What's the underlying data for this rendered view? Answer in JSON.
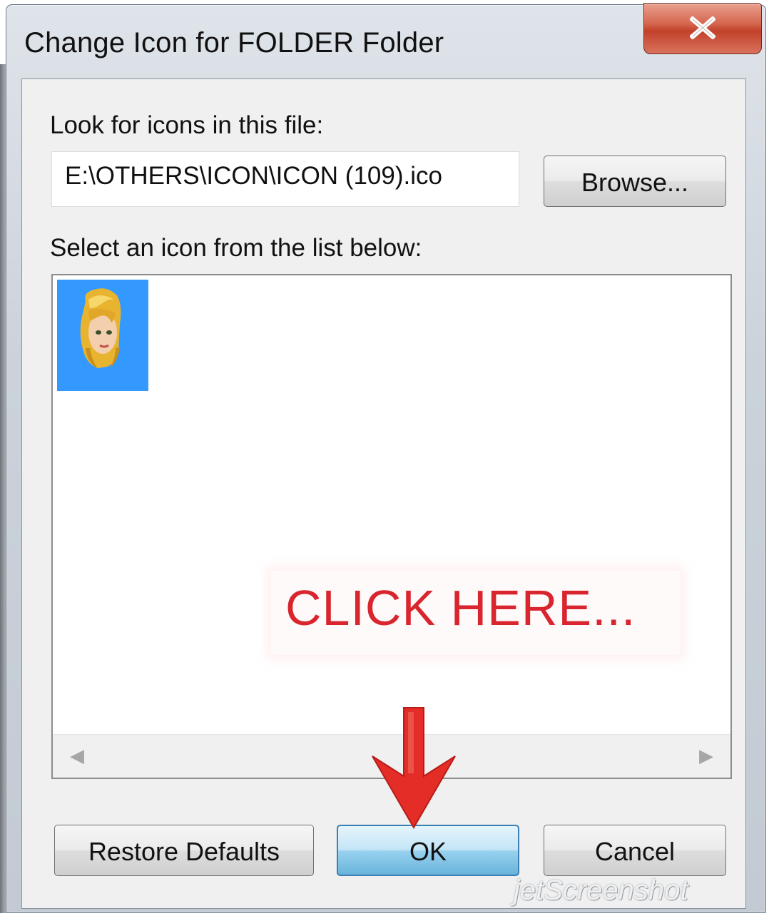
{
  "window": {
    "title": "Change Icon for FOLDER Folder",
    "close_icon": "close-icon"
  },
  "file_section": {
    "label": "Look for icons in this file:",
    "path_value": "E:\\OTHERS\\ICON\\ICON (109).ico",
    "browse_label": "Browse..."
  },
  "icon_list": {
    "label": "Select an icon from the list below:",
    "items": [
      {
        "icon": "blonde-girl-avatar-icon",
        "selected": true
      }
    ],
    "scroll_left": "◀",
    "scroll_right": "▶"
  },
  "annotation": {
    "callout_text": "CLICK HERE...",
    "arrow_color": "#e52d27"
  },
  "buttons": {
    "restore_defaults": "Restore Defaults",
    "ok": "OK",
    "cancel": "Cancel"
  },
  "watermark": {
    "text": "jetScreenshot"
  },
  "colors": {
    "selection": "#3399ff",
    "callout_text": "#d9252e",
    "ok_border": "#3c7fb1"
  }
}
